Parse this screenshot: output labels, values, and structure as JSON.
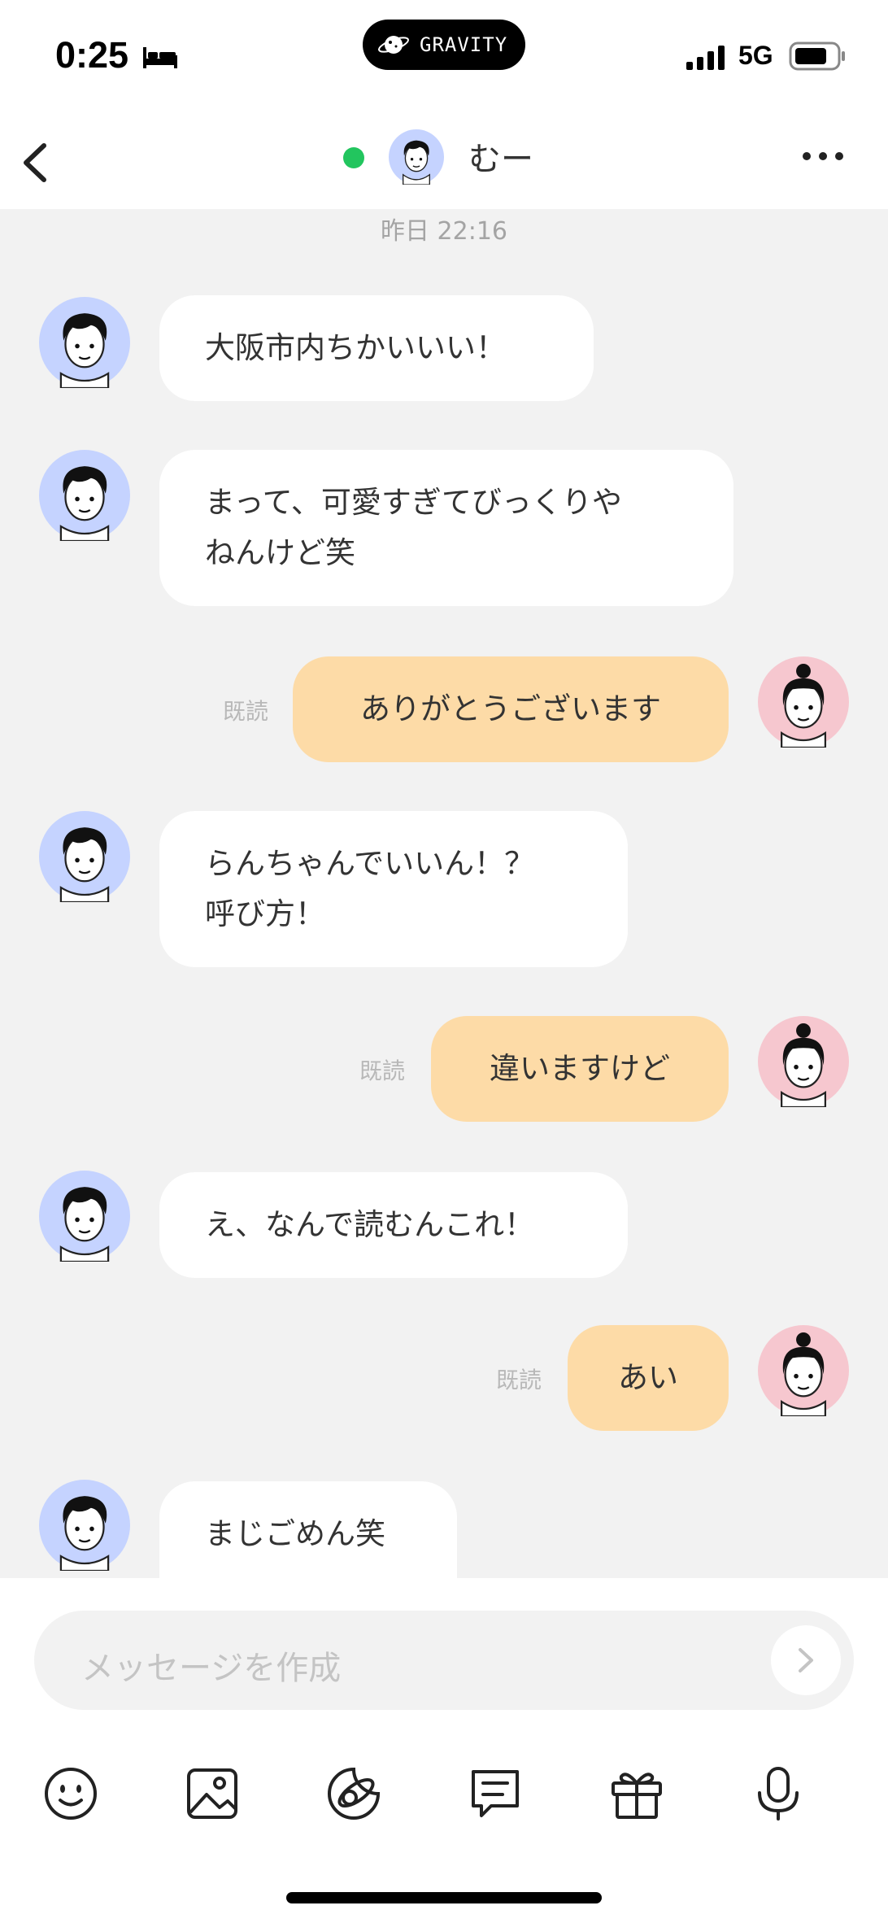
{
  "status_bar": {
    "time": "0:25",
    "bed_icon": "bed-icon",
    "dynamic_island_label": "GRAVITY",
    "network": "5G",
    "signal_icon": "cellular-signal-icon",
    "battery_icon": "battery-icon"
  },
  "header": {
    "back_icon": "chevron-left-icon",
    "online_indicator_color": "#22c55e",
    "contact_name": "むー",
    "more_icon": "ellipsis-icon"
  },
  "chat": {
    "timestamp": "昨日 22:16",
    "read_label": "既読",
    "colors": {
      "incoming_bubble": "#ffffff",
      "outgoing_bubble": "#fddba7",
      "incoming_avatar_bg": "#c5d3ff",
      "outgoing_avatar_bg": "#f6c7cf"
    },
    "messages": [
      {
        "sender": "contact",
        "lines": [
          "大阪市内ちかいいい！"
        ]
      },
      {
        "sender": "contact",
        "lines": [
          "まって、可愛すぎてびっくりや",
          "ねんけど笑"
        ]
      },
      {
        "sender": "me",
        "lines": [
          "ありがとうございます"
        ],
        "read": "既読"
      },
      {
        "sender": "contact",
        "lines": [
          "らんちゃんでいいん！？",
          "呼び方！"
        ]
      },
      {
        "sender": "me",
        "lines": [
          "違いますけど"
        ],
        "read": "既読"
      },
      {
        "sender": "contact",
        "lines": [
          "え、なんで読むんこれ！"
        ]
      },
      {
        "sender": "me",
        "lines": [
          "あい"
        ],
        "read": "既読"
      },
      {
        "sender": "contact",
        "lines": [
          "まじごめん笑"
        ]
      }
    ]
  },
  "composer": {
    "placeholder": "メッセージを作成",
    "send_icon": "chevron-right-icon",
    "tools": [
      "emoji-icon",
      "image-icon",
      "sticker-icon",
      "message-template-icon",
      "gift-icon",
      "microphone-icon"
    ]
  }
}
